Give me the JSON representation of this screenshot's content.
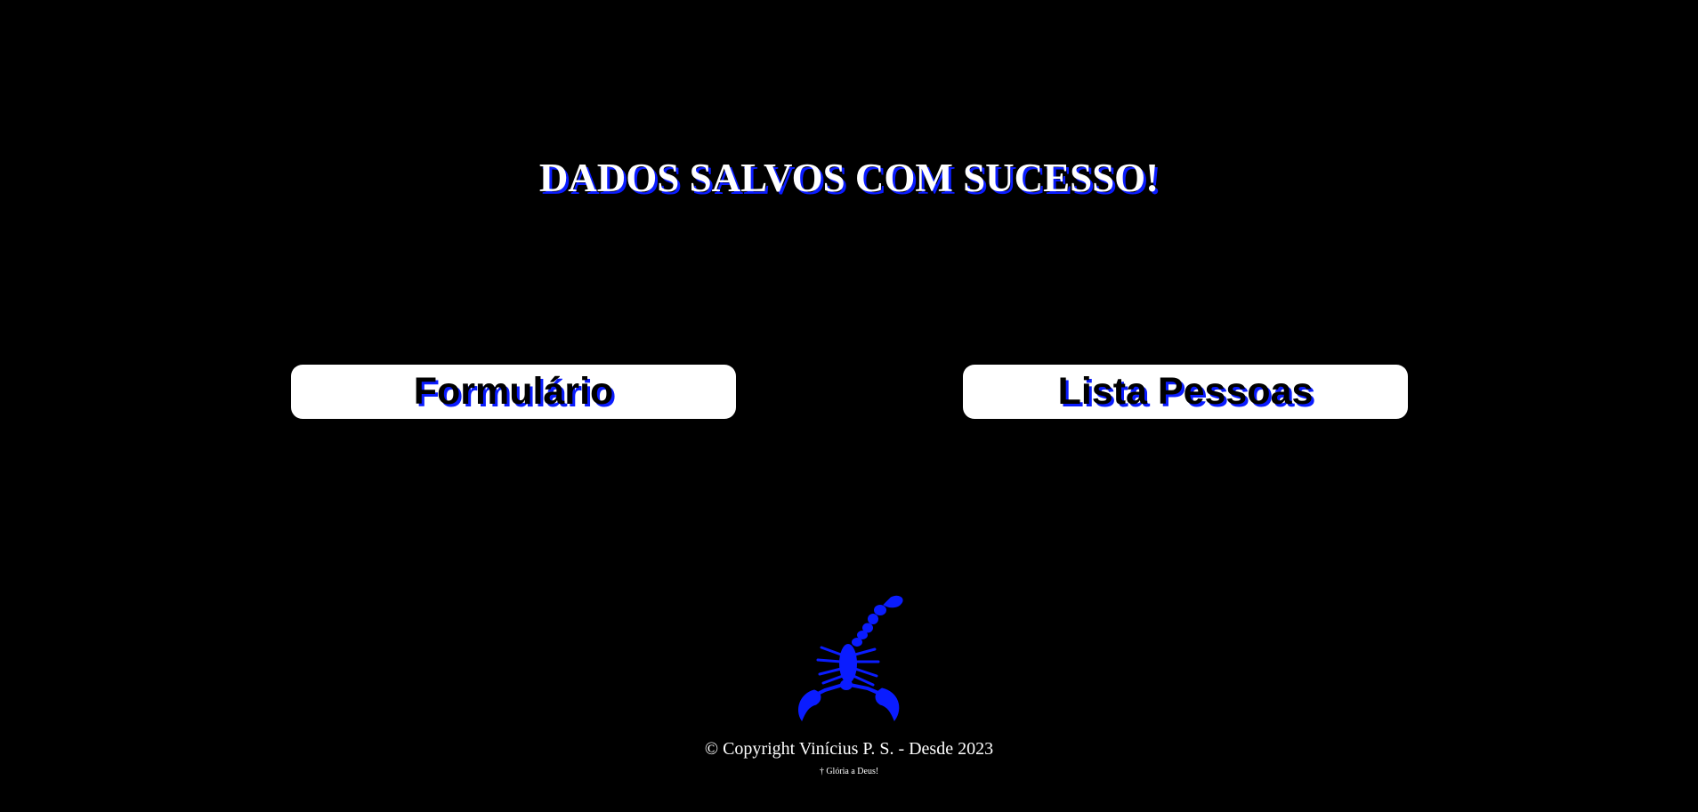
{
  "page": {
    "title": "DADOS SALVOS COM SUCESSO!"
  },
  "nav": {
    "formulario_label": "Formulário",
    "lista_label": "Lista Pessoas"
  },
  "logo": {
    "icon": "scorpion-icon",
    "color": "#0a1cff"
  },
  "footer": {
    "copyright": "© Copyright Vinícius P. S. - Desde 2023",
    "gloria": "† Glória a Deus!"
  },
  "colors": {
    "background": "#000000",
    "accent_shadow": "#0a1cff",
    "button_bg": "#ffffff"
  }
}
